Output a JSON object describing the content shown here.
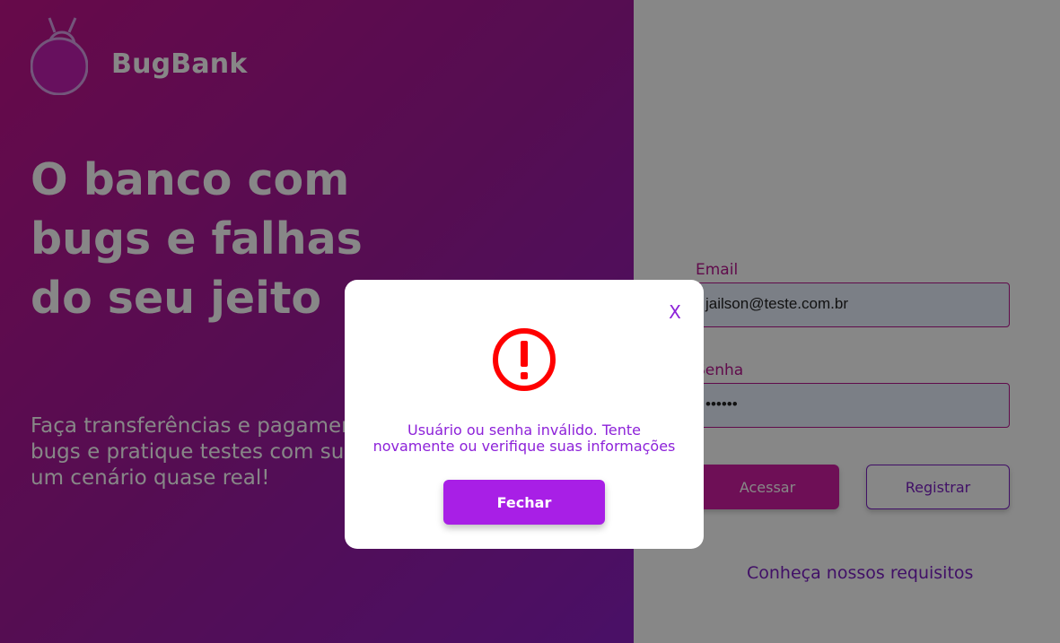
{
  "brand": {
    "name": "BugBank",
    "logo_icon": "bug-icon"
  },
  "hero": {
    "headline_lines": [
      "O banco com",
      "bugs e falhas",
      "do seu jeito"
    ],
    "subtext_lines": [
      "Faça transferências e pagamentos",
      "bugs e pratique testes com sucesso",
      "um cenário quase real!"
    ]
  },
  "login_form": {
    "email_label": "Email",
    "email_value": "jailson@teste.com.br",
    "password_label": "Senha",
    "password_value": "••••••",
    "submit_label": "Acessar",
    "register_label": "Registrar",
    "requirements_link": "Conheça nossos requisitos"
  },
  "modal": {
    "close_label": "X",
    "icon": "error-alert-icon",
    "message_lines": [
      "Usuário ou senha inválido. Tente",
      "novamente ou verifique suas informações"
    ],
    "button_label": "Fechar"
  },
  "colors": {
    "primary": "#a81fe6",
    "accent": "#d01ea3",
    "error": "#ff0000"
  }
}
